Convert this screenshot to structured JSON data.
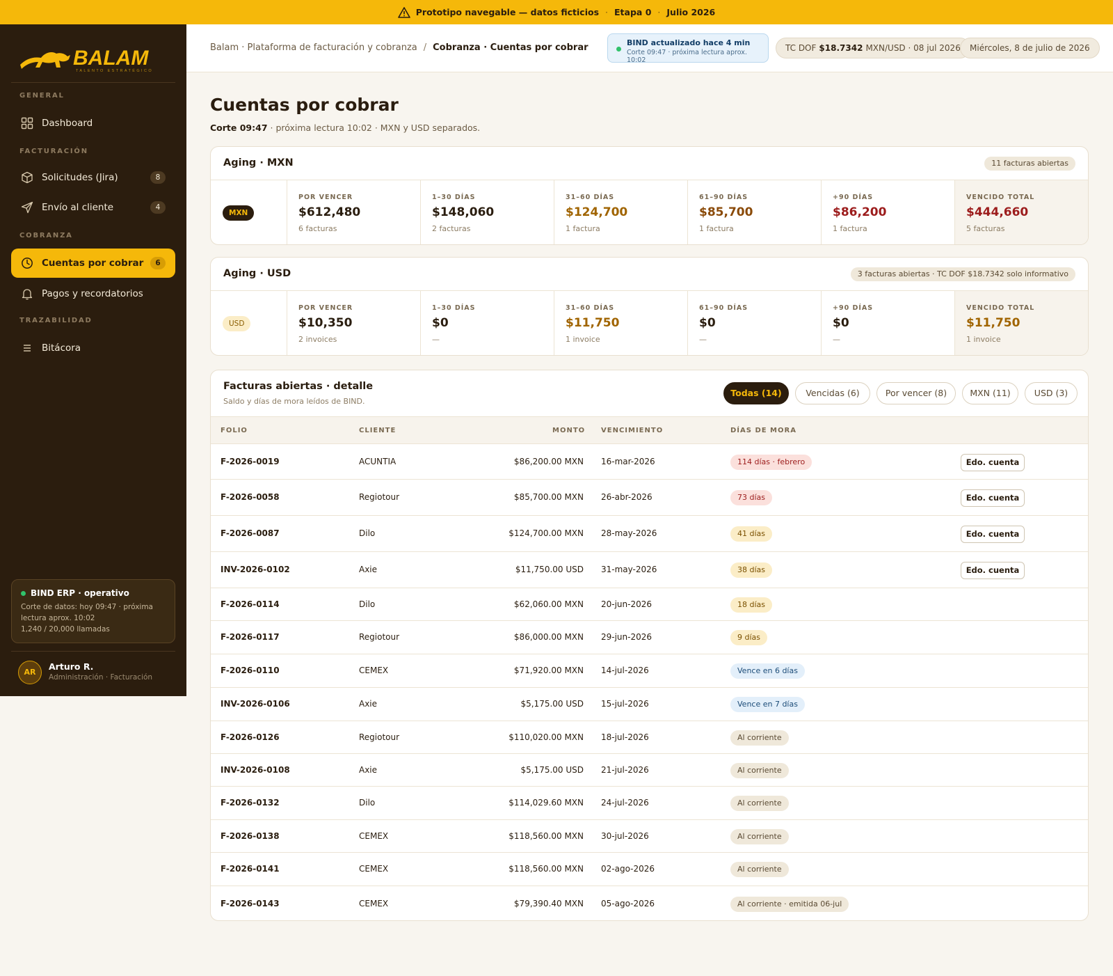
{
  "banner": {
    "title": "Prototipo navegable — datos ficticios",
    "stage": "Etapa 0",
    "period": "Julio 2026"
  },
  "sidebar": {
    "logo_text": "BALAM",
    "logo_tagline": "TALENTO ESTRATÉGICO",
    "sections": {
      "general": "GENERAL",
      "facturacion": "FACTURACIÓN",
      "cobranza": "COBRANZA",
      "trazabilidad": "TRAZABILIDAD"
    },
    "items": [
      {
        "label": "Dashboard",
        "icon": "grid-icon"
      },
      {
        "label": "Solicitudes (Jira)",
        "icon": "box-icon",
        "badge": "8"
      },
      {
        "label": "Envío al cliente",
        "icon": "send-icon",
        "badge": "4"
      },
      {
        "label": "Cuentas por cobrar",
        "icon": "clock-icon",
        "badge": "6",
        "active": true
      },
      {
        "label": "Pagos y recordatorios",
        "icon": "bell-icon"
      },
      {
        "label": "Bitácora",
        "icon": "list-icon"
      }
    ],
    "bind_status": {
      "title": "BIND ERP · operativo",
      "detail": "Corte de datos: hoy 09:47 · próxima lectura aprox. 10:02",
      "calls": "1,240 / 20,000 llamadas"
    },
    "user": {
      "initials": "AR",
      "name": "Arturo R.",
      "role": "Administración · Facturación"
    }
  },
  "topbar": {
    "breadcrumb_root": "Balam · Plataforma de facturación y cobranza",
    "breadcrumb_sep": "/",
    "breadcrumb_current": "Cobranza · Cuentas por cobrar",
    "bind_title": "BIND actualizado hace 4 min",
    "bind_detail": "Corte 09:47 · próxima lectura aprox. 10:02",
    "tc_label": "TC DOF",
    "tc_value": "$18.7342",
    "tc_detail": "MXN/USD · 08 jul 2026",
    "date": "Miércoles, 8 de julio de 2026"
  },
  "page": {
    "title": "Cuentas por cobrar",
    "subtitle_strong": "Corte 09:47",
    "subtitle_rest": " · próxima lectura 10:02 · MXN y USD separados."
  },
  "aging_mxn": {
    "title": "Aging · MXN",
    "tag": "11 facturas abiertas",
    "currency": "MXN",
    "buckets": [
      {
        "label": "POR VENCER",
        "value": "$612,480",
        "sub": "6 facturas"
      },
      {
        "label": "1–30 DÍAS",
        "value": "$148,060",
        "sub": "2 facturas"
      },
      {
        "label": "31–60 DÍAS",
        "value": "$124,700",
        "sub": "1 factura"
      },
      {
        "label": "61–90 DÍAS",
        "value": "$85,700",
        "sub": "1 factura"
      },
      {
        "label": "+90 DÍAS",
        "value": "$86,200",
        "sub": "1 factura"
      },
      {
        "label": "VENCIDO TOTAL",
        "value": "$444,660",
        "sub": "5 facturas"
      }
    ]
  },
  "aging_usd": {
    "title": "Aging · USD",
    "tag": "3 facturas abiertas · TC DOF $18.7342 solo informativo",
    "currency": "USD",
    "buckets": [
      {
        "label": "POR VENCER",
        "value": "$10,350",
        "sub": "2 invoices"
      },
      {
        "label": "1–30 DÍAS",
        "value": "$0",
        "sub": "—"
      },
      {
        "label": "31–60 DÍAS",
        "value": "$11,750",
        "sub": "1 invoice"
      },
      {
        "label": "61–90 DÍAS",
        "value": "$0",
        "sub": "—"
      },
      {
        "label": "+90 DÍAS",
        "value": "$0",
        "sub": "—"
      },
      {
        "label": "VENCIDO TOTAL",
        "value": "$11,750",
        "sub": "1 invoice"
      }
    ]
  },
  "detail": {
    "title": "Facturas abiertas · detalle",
    "subtitle": "Saldo y días de mora leídos de BIND.",
    "filters": [
      "Todas (14)",
      "Vencidas (6)",
      "Por vencer (8)",
      "MXN (11)",
      "USD (3)"
    ],
    "columns": [
      "FOLIO",
      "CLIENTE",
      "MONTO",
      "VENCIMIENTO",
      "DÍAS DE MORA"
    ],
    "action_label": "Edo. cuenta",
    "rows": [
      {
        "folio": "F-2026-0019",
        "cliente": "ACUNTIA",
        "monto": "$86,200.00 MXN",
        "vence": "16-mar-2026",
        "mora": "114 días · febrero",
        "tone": "red",
        "action": true
      },
      {
        "folio": "F-2026-0058",
        "cliente": "Regiotour",
        "monto": "$85,700.00 MXN",
        "vence": "26-abr-2026",
        "mora": "73 días",
        "tone": "red",
        "action": true
      },
      {
        "folio": "F-2026-0087",
        "cliente": "Dilo",
        "monto": "$124,700.00 MXN",
        "vence": "28-may-2026",
        "mora": "41 días",
        "tone": "amber",
        "action": true
      },
      {
        "folio": "INV-2026-0102",
        "cliente": "Axie",
        "monto": "$11,750.00 USD",
        "vence": "31-may-2026",
        "mora": "38 días",
        "tone": "amber",
        "action": true
      },
      {
        "folio": "F-2026-0114",
        "cliente": "Dilo",
        "monto": "$62,060.00 MXN",
        "vence": "20-jun-2026",
        "mora": "18 días",
        "tone": "amber",
        "action": false
      },
      {
        "folio": "F-2026-0117",
        "cliente": "Regiotour",
        "monto": "$86,000.00 MXN",
        "vence": "29-jun-2026",
        "mora": "9 días",
        "tone": "amber",
        "action": false
      },
      {
        "folio": "F-2026-0110",
        "cliente": "CEMEX",
        "monto": "$71,920.00 MXN",
        "vence": "14-jul-2026",
        "mora": "Vence en 6 días",
        "tone": "blue",
        "action": false
      },
      {
        "folio": "INV-2026-0106",
        "cliente": "Axie",
        "monto": "$5,175.00 USD",
        "vence": "15-jul-2026",
        "mora": "Vence en 7 días",
        "tone": "blue",
        "action": false
      },
      {
        "folio": "F-2026-0126",
        "cliente": "Regiotour",
        "monto": "$110,020.00 MXN",
        "vence": "18-jul-2026",
        "mora": "Al corriente",
        "tone": "gray",
        "action": false
      },
      {
        "folio": "INV-2026-0108",
        "cliente": "Axie",
        "monto": "$5,175.00 USD",
        "vence": "21-jul-2026",
        "mora": "Al corriente",
        "tone": "gray",
        "action": false
      },
      {
        "folio": "F-2026-0132",
        "cliente": "Dilo",
        "monto": "$114,029.60 MXN",
        "vence": "24-jul-2026",
        "mora": "Al corriente",
        "tone": "gray",
        "action": false
      },
      {
        "folio": "F-2026-0138",
        "cliente": "CEMEX",
        "monto": "$118,560.00 MXN",
        "vence": "30-jul-2026",
        "mora": "Al corriente",
        "tone": "gray",
        "action": false
      },
      {
        "folio": "F-2026-0141",
        "cliente": "CEMEX",
        "monto": "$118,560.00 MXN",
        "vence": "02-ago-2026",
        "mora": "Al corriente",
        "tone": "gray",
        "action": false
      },
      {
        "folio": "F-2026-0143",
        "cliente": "CEMEX",
        "monto": "$79,390.40 MXN",
        "vence": "05-ago-2026",
        "mora": "Al corriente · emitida 06-jul",
        "tone": "gray",
        "action": false
      }
    ]
  },
  "colors": {
    "accent": "#f5b80a",
    "sidebar": "#2b1d0e",
    "danger": "#9c1c1c",
    "info": "#1c4c78",
    "ok": "#31c26b"
  }
}
